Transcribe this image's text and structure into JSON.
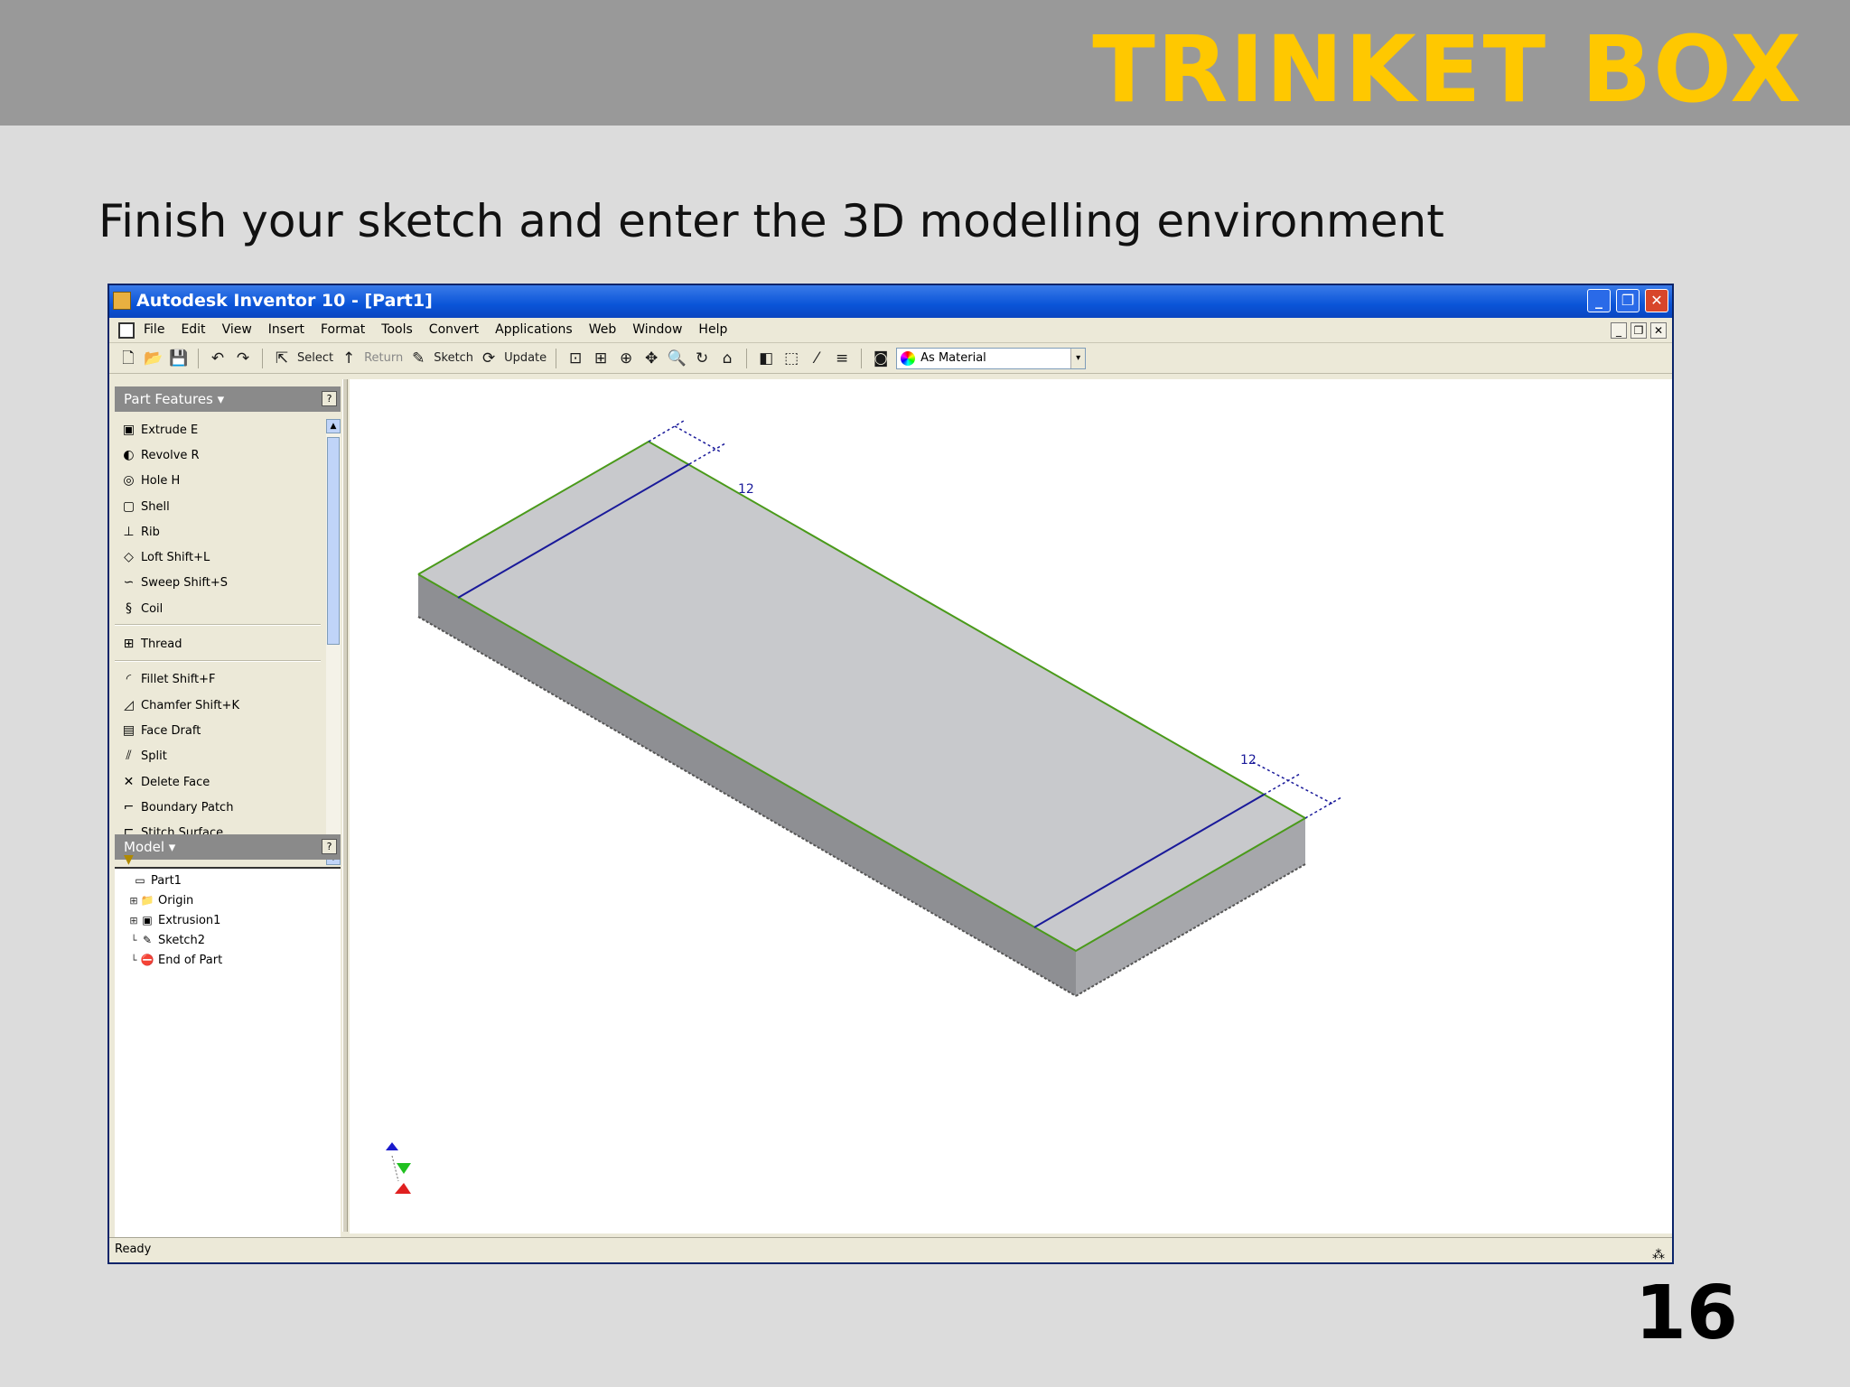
{
  "slide": {
    "title": "TRINKET BOX",
    "subtitle": "Finish your sketch and enter the 3D modelling environment",
    "page_number": "16"
  },
  "window": {
    "title": "Autodesk Inventor 10 - [Part1]",
    "controls": {
      "minimize": "_",
      "maximize": "❐",
      "close": "✕"
    }
  },
  "menubar": {
    "items": [
      "File",
      "Edit",
      "View",
      "Insert",
      "Format",
      "Tools",
      "Convert",
      "Applications",
      "Web",
      "Window",
      "Help"
    ],
    "mdi_controls": {
      "minimize": "_",
      "restore": "❐",
      "close": "✕"
    }
  },
  "toolbar": {
    "select_label": "Select",
    "return_label": "Return",
    "sketch_label": "Sketch",
    "update_label": "Update",
    "style_value": "As Material"
  },
  "panel": {
    "header": "Part Features ▾",
    "features": [
      {
        "label": "Extrude   E",
        "icon": "extrude-icon"
      },
      {
        "label": "Revolve   R",
        "icon": "revolve-icon"
      },
      {
        "label": "Hole   H",
        "icon": "hole-icon"
      },
      {
        "label": "Shell",
        "icon": "shell-icon"
      },
      {
        "label": "Rib",
        "icon": "rib-icon"
      },
      {
        "label": "Loft   Shift+L",
        "icon": "loft-icon"
      },
      {
        "label": "Sweep   Shift+S",
        "icon": "sweep-icon"
      },
      {
        "label": "Coil",
        "icon": "coil-icon"
      },
      {
        "label": "Thread",
        "icon": "thread-icon"
      },
      {
        "label": "Fillet   Shift+F",
        "icon": "fillet-icon"
      },
      {
        "label": "Chamfer   Shift+K",
        "icon": "chamfer-icon"
      },
      {
        "label": "Face Draft",
        "icon": "face-draft-icon"
      },
      {
        "label": "Split",
        "icon": "split-icon"
      },
      {
        "label": "Delete Face",
        "icon": "delete-face-icon"
      },
      {
        "label": "Boundary Patch",
        "icon": "boundary-patch-icon"
      },
      {
        "label": "Stitch Surface",
        "icon": "stitch-surface-icon"
      }
    ]
  },
  "model": {
    "header": "Model ▾",
    "tree": [
      {
        "label": "Part1",
        "level": 0
      },
      {
        "label": "Origin",
        "level": 1
      },
      {
        "label": "Extrusion1",
        "level": 1
      },
      {
        "label": "Sketch2",
        "level": 1
      },
      {
        "label": "End of Part",
        "level": 1
      }
    ]
  },
  "viewport": {
    "dim_top": "12",
    "dim_bottom": "12",
    "colors": {
      "top_face": "#c8c9cc",
      "front_face": "#8e8f93",
      "side_face": "#a6a7ab",
      "edge": "#4a9a1a",
      "sketch_line": "#1a1a9a"
    }
  },
  "status": {
    "text": "Ready"
  }
}
